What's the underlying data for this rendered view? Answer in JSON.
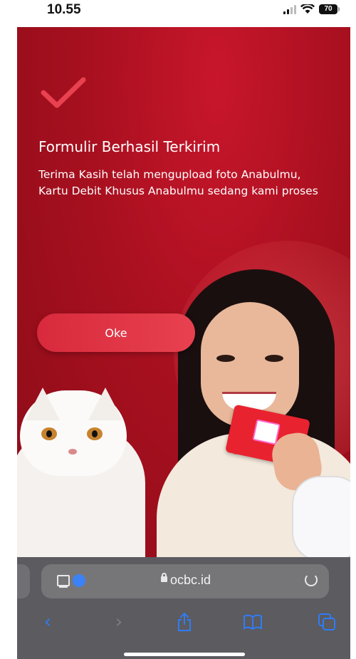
{
  "status_bar": {
    "time": "10.55",
    "battery_level": "70"
  },
  "confirmation": {
    "title": "Formulir Berhasil Terkirim",
    "message_line1": "Terima Kasih telah mengupload foto Anabulmu,",
    "message_line2": "Kartu Debit Khusus Anabulmu sedang kami proses",
    "ok_button_label": "Oke"
  },
  "browser": {
    "url": "ocbc.id"
  },
  "colors": {
    "brand_red": "#c8162c",
    "check_red": "#e8414f",
    "link_blue": "#2f7cf6"
  },
  "icons": [
    "check-icon",
    "page-menu-icon",
    "download-icon",
    "lock-icon",
    "reload-icon",
    "back-icon",
    "forward-icon",
    "share-icon",
    "bookmarks-icon",
    "tabs-icon"
  ]
}
